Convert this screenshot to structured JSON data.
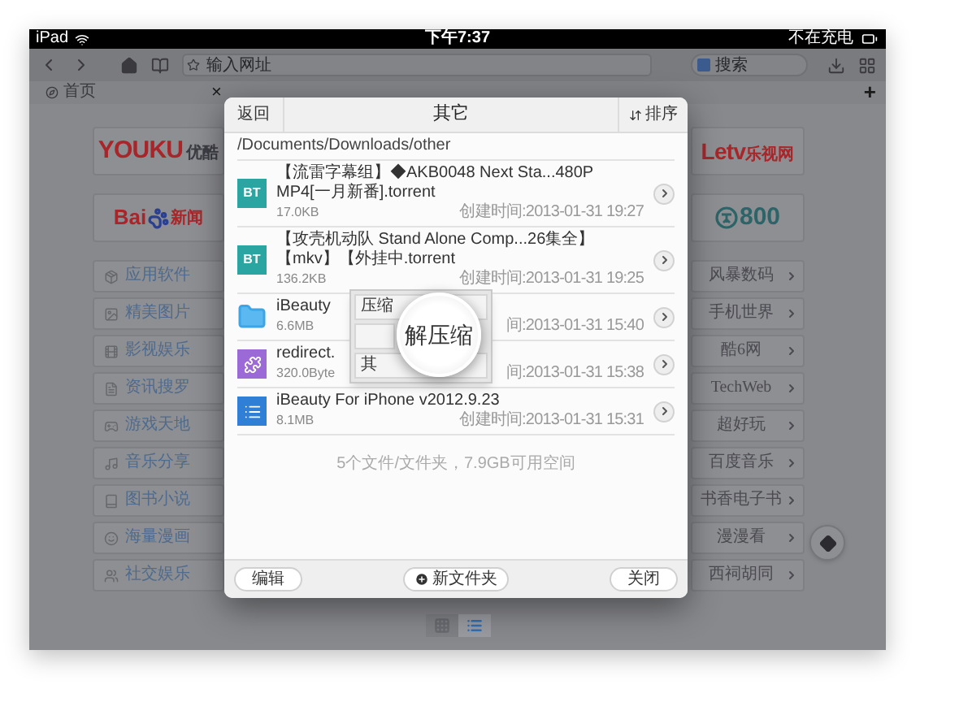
{
  "status_bar": {
    "device": "iPad",
    "time": "下午7:37",
    "charging": "不在充电"
  },
  "toolbar": {
    "url_placeholder": "输入网址",
    "search_placeholder": "搜索"
  },
  "tab": {
    "label": "首页",
    "close": "×",
    "new_tab": "+"
  },
  "left_logos": [
    {
      "kind": "youku",
      "parts": [
        "YOUKU",
        "优酷"
      ]
    },
    {
      "kind": "baidu",
      "parts": [
        "Bai",
        "新闻"
      ]
    }
  ],
  "right_logos": [
    {
      "kind": "letv",
      "parts": [
        "Letv",
        "乐视网"
      ]
    },
    {
      "kind": "eight",
      "parts": [
        "800"
      ]
    }
  ],
  "categories": [
    "应用软件",
    "精美图片",
    "影视娱乐",
    "资讯搜罗",
    "游戏天地",
    "音乐分享",
    "图书小说",
    "海量漫画",
    "社交娱乐"
  ],
  "sites": [
    "风暴数码",
    "手机世界",
    "酷6网",
    "TechWeb",
    "超好玩",
    "百度音乐",
    "书香电子书",
    "漫漫看",
    "西祠胡同"
  ],
  "dialog": {
    "back": "返回",
    "title": "其它",
    "sort": "排序",
    "path": "/Documents/Downloads/other",
    "files": [
      {
        "kind": "bt",
        "badge": "BT",
        "name": "【流雷字幕组】◆AKB0048 Next Sta...480P MP4[一月新番].torrent",
        "size": "17.0KB",
        "time": "创建时间:2013-01-31 19:27"
      },
      {
        "kind": "bt",
        "badge": "BT",
        "name": "【攻壳机动队 Stand Alone Comp...26集全】【mkv】【外挂中.torrent",
        "size": "136.2KB",
        "time": "创建时间:2013-01-31 19:25"
      },
      {
        "kind": "folder",
        "name": "iBeauty",
        "size": "6.6MB",
        "time": "间:2013-01-31 15:40"
      },
      {
        "kind": "plugin",
        "name": "redirect.",
        "size": "320.0Byte",
        "time": "间:2013-01-31 15:38"
      },
      {
        "kind": "document",
        "name": "iBeauty For iPhone v2012.9.23",
        "size": "8.1MB",
        "time": "创建时间:2013-01-31 15:31"
      }
    ],
    "summary": "5个文件/文件夹，7.9GB可用空间",
    "edit": "编辑",
    "new_folder": "新文件夹",
    "close": "关闭"
  },
  "popup": {
    "options": [
      "压缩",
      "其"
    ],
    "magnified": "解压缩"
  },
  "view_toggle": [
    {
      "kind": "grid",
      "selected": false
    },
    {
      "kind": "list",
      "selected": true
    }
  ]
}
